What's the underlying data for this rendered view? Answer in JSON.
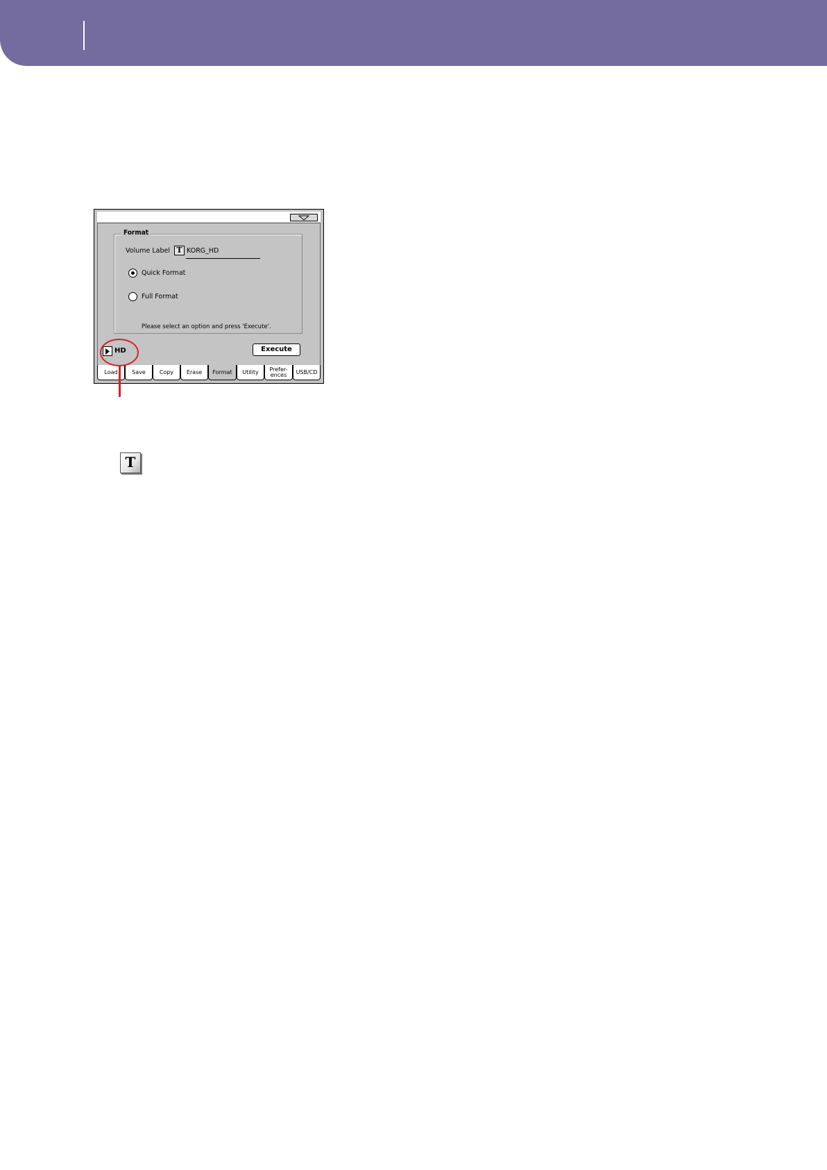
{
  "screen": {
    "group_title": "Format",
    "volume_label_caption": "Volume Label",
    "text_edit_glyph": "T",
    "volume_label_value": "KORG_HD",
    "options": [
      {
        "label": "Quick Format",
        "selected": true
      },
      {
        "label": "Full Format",
        "selected": false
      }
    ],
    "hint": "Please select an option and press 'Execute'.",
    "execute_label": "Execute",
    "device_label": "HD",
    "tabs": [
      {
        "label": "Load",
        "active": false
      },
      {
        "label": "Save",
        "active": false
      },
      {
        "label": "Copy",
        "active": false
      },
      {
        "label": "Erase",
        "active": false
      },
      {
        "label": "Format",
        "active": true
      },
      {
        "label": "Utility",
        "active": false
      },
      {
        "label": "Prefer-\nences",
        "active": false
      },
      {
        "label": "USB/CD",
        "active": false
      }
    ]
  },
  "callout": {
    "icon_glyph": "T",
    "icon_name": "text-edit-icon",
    "highlight_color": "#d6222a"
  },
  "banner_color": "#746c9f"
}
